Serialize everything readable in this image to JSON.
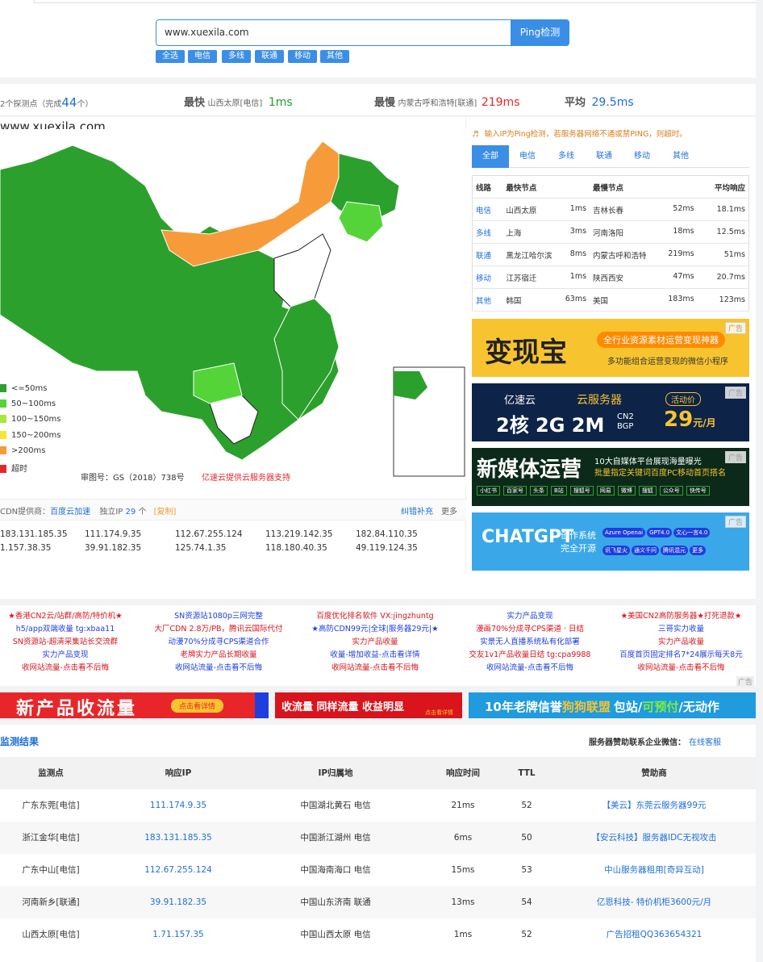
{
  "search": {
    "value": "www.xuexila.com",
    "button": "Ping检测"
  },
  "filters": [
    "全选",
    "电信",
    "多线",
    "联通",
    "移动",
    "其他"
  ],
  "summary": {
    "probe_prefix": "2个探测点（完成",
    "probe_count": "44",
    "probe_suffix": "个）",
    "fastest_label": "最快",
    "fastest_node": "山西太原[电信]",
    "fastest_value": "1ms",
    "slowest_label": "最慢",
    "slowest_node": "内蒙古呼和浩特[联通]",
    "slowest_value": "219ms",
    "avg_label": "平均",
    "avg_value": "29.5ms"
  },
  "map": {
    "site": "www.xuexila.com",
    "legend": [
      {
        "label": "<=50ms",
        "color": "#2ca02c"
      },
      {
        "label": "50~100ms",
        "color": "#55d43a"
      },
      {
        "label": "100~150ms",
        "color": "#a8e838"
      },
      {
        "label": "150~200ms",
        "color": "#f5e633"
      },
      {
        "label": ">200ms",
        "color": "#f79b3a"
      },
      {
        "label": "超时",
        "color": "#e8262a"
      }
    ],
    "approval": "审图号：GS（2018）738号",
    "provider": "亿速云提供云服务器支持"
  },
  "notice": "输入IP为Ping检测，若服务器网络不通或禁PING，则超时。",
  "tabs": [
    "全部",
    "电信",
    "多线",
    "联通",
    "移动",
    "其他"
  ],
  "stats_table": {
    "headers": [
      "线路",
      "最快节点",
      "最慢节点",
      "平均响应"
    ],
    "rows": [
      {
        "line": "电信",
        "fast": "山西太原",
        "fast_ms": "1ms",
        "slow": "吉林长春",
        "slow_ms": "52ms",
        "avg": "18.1ms"
      },
      {
        "line": "多线",
        "fast": "上海",
        "fast_ms": "3ms",
        "slow": "河南洛阳",
        "slow_ms": "18ms",
        "avg": "12.5ms"
      },
      {
        "line": "联通",
        "fast": "黑龙江哈尔滨",
        "fast_ms": "8ms",
        "slow": "内蒙古呼和浩特",
        "slow_ms": "219ms",
        "avg": "51ms"
      },
      {
        "line": "移动",
        "fast": "江苏宿迁",
        "fast_ms": "1ms",
        "slow": "陕西西安",
        "slow_ms": "47ms",
        "avg": "20.7ms"
      },
      {
        "line": "其他",
        "fast": "韩国",
        "fast_ms": "63ms",
        "slow": "美国",
        "slow_ms": "183ms",
        "avg": "123ms"
      }
    ]
  },
  "ads": {
    "tag": "广告",
    "ad1": {
      "title": "变现宝",
      "line1": "全行业资源素材运营变现神器",
      "line2": "多功能组合运营变现的微信小程序"
    },
    "ad2": {
      "brand": "亿速云",
      "product": "云服务器",
      "badge": "活动价",
      "spec": "2核 2G 2M",
      "net": "CN2 BGP",
      "price": "29",
      "unit": "元/月"
    },
    "ad3": {
      "title": "新媒体运营",
      "line1": "10大自媒体平台展现海量曝光",
      "line2": "批量指定关键词百度PC移动首页搭名",
      "chips": [
        "小红书",
        "百家号",
        "头条",
        "B站",
        "搜狐号",
        "网易",
        "微博",
        "搜狐",
        "公众号",
        "快传号"
      ]
    },
    "ad4": {
      "title": "CHATGPT",
      "line1": "创作系统",
      "line2": "完全开源",
      "chips": [
        "Azure Openai",
        "GPT4.0",
        "文心一言4.0",
        "讯飞星火",
        "通义千问",
        "腾讯混元",
        "更多"
      ]
    }
  },
  "cdn_bar": {
    "prefix": "CDN提供商：",
    "provider": "百度云加速",
    "ip_label": "独立IP",
    "ip_count": "29",
    "ip_unit": "个",
    "copy": "[复制]",
    "fix": "纠错补充",
    "more": "更多"
  },
  "ip_list": [
    "183.131.185.35",
    "111.174.9.35",
    "112.67.255.124",
    "113.219.142.35",
    "182.84.110.35",
    "1.157.38.35",
    "39.91.182.35",
    "125.74.1.35",
    "118.180.40.35",
    "49.119.124.35"
  ],
  "text_ads": [
    [
      "★香港CN2云/站群/高防/特价机★",
      "h5/app双端收量 tg:xbaa11",
      "SN资源站-超清采集站长交流群",
      "实力产品变现",
      "收网站流量-点击看不后悔"
    ],
    [
      "SN资源站1080p三网完整",
      "大厂CDN 2.8万/PB，腾讯云国际代付",
      "动漫70%分成寻CPS渠道合作",
      "老牌实力产品长期收量",
      "收网站流量-点击看不后悔"
    ],
    [
      "百度优化排名软件 VX:jingzhuntg",
      "★高防CDN99元|全球|服务器29元|★",
      "实力产品收量",
      "收量-增加收益-点击看详情",
      "收网站流量-点击看不后悔"
    ],
    [
      "实力产品变现",
      "漫画70%分成寻CPS渠道 · 日结",
      "实景无人直播系统私有化部署",
      "交友1v1产品收量日结 tg:cpa9988",
      "收网站流量-点击看不后悔"
    ],
    [
      "★美国CN2高防服务器★打死退款★",
      "三哥实力收量",
      "实力产品收量",
      "百度首页固定排名7*24展示每天8元",
      "收网站流量-点击看不后悔"
    ]
  ],
  "banners": {
    "b1": "新产品收流量",
    "b1_btn": "点击看详情",
    "b2": "收流量 同样流量 收益明显",
    "b2_btn": "点击看详情",
    "b3_pre": "10年老牌信誉",
    "b3_mid": "狗狗联盟",
    "b3_a": "包站/",
    "b3_b": "可预付",
    "b3_c": "/无动作"
  },
  "results": {
    "title": "监测结果",
    "sponsor_label": "服务器赞助联系企业微信：",
    "sponsor_link": "在线客服",
    "headers": [
      "监测点",
      "响应IP",
      "IP归属地",
      "响应时间",
      "TTL",
      "赞助商"
    ],
    "rows": [
      {
        "node": "广东东莞[电信]",
        "ip": "111.174.9.35",
        "loc": "中国湖北黄石 电信",
        "time": "21ms",
        "ttl": "52",
        "sponsor": "【美云】东莞云服务器99元"
      },
      {
        "node": "浙江金华[电信]",
        "ip": "183.131.185.35",
        "loc": "中国浙江湖州 电信",
        "time": "6ms",
        "ttl": "50",
        "sponsor": "【安云科技】服务器IDC无视攻击"
      },
      {
        "node": "广东中山[电信]",
        "ip": "112.67.255.124",
        "loc": "中国海南海口 电信",
        "time": "15ms",
        "ttl": "53",
        "sponsor": "中山服务器租用[奇异互动]"
      },
      {
        "node": "河南新乡[联通]",
        "ip": "39.91.182.35",
        "loc": "中国山东济南 联通",
        "time": "13ms",
        "ttl": "54",
        "sponsor": "亿恩科技- 特价机柜3600元/月"
      },
      {
        "node": "山西太原[电信]",
        "ip": "1.71.157.35",
        "loc": "中国山西太原 电信",
        "time": "1ms",
        "ttl": "52",
        "sponsor": "广告招租QQ363654321"
      }
    ]
  }
}
